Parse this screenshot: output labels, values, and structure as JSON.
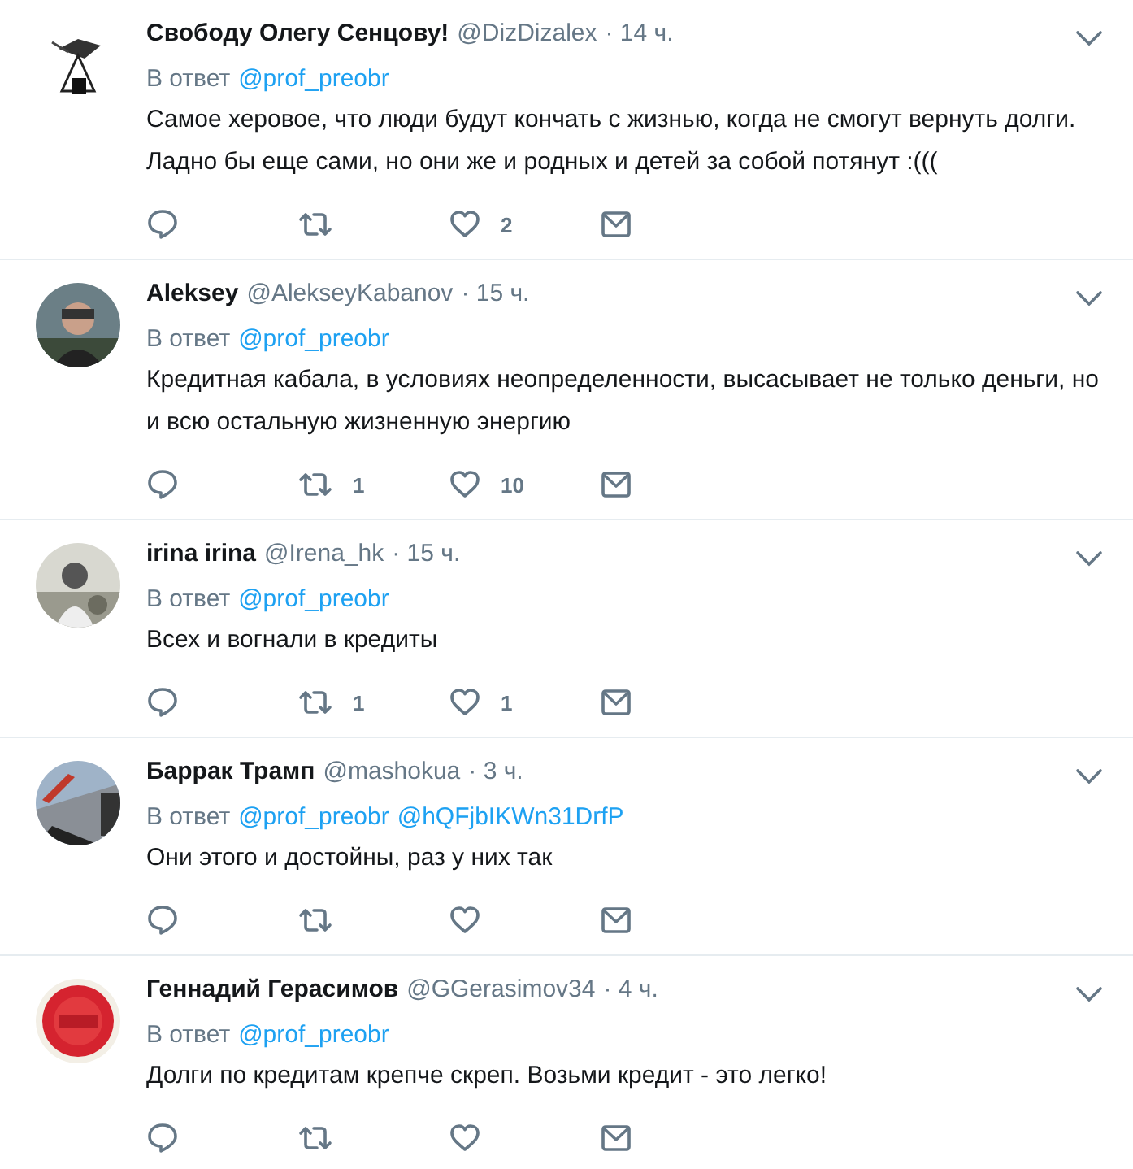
{
  "tweets": [
    {
      "name": "Свободу Олегу Сенцову!",
      "handle": "@DizDizalex",
      "time": "· 14 ч.",
      "reply_label": "В ответ",
      "mentions": [
        "@prof_preobr"
      ],
      "text": "Самое херовое, что люди будут кончать с жизнью, когда не смогут вернуть долги. Ладно бы еще сами, но они же и родных и детей за собой потянут :(((",
      "likes": "2"
    },
    {
      "name": "Aleksey",
      "handle": "@AlekseyKabanov",
      "time": "· 15 ч.",
      "reply_label": "В ответ",
      "mentions": [
        "@prof_preobr"
      ],
      "text": "Кредитная кабала, в условиях неопределенности, высасывает не только деньги, но и всю остальную жизненную энергию",
      "retweets": "1",
      "likes": "10"
    },
    {
      "name": "irina irina",
      "handle": "@Irena_hk",
      "time": "· 15 ч.",
      "reply_label": "В ответ",
      "mentions": [
        "@prof_preobr"
      ],
      "text": "Всех и вогнали в кредиты",
      "retweets": "1",
      "likes": "1"
    },
    {
      "name": "Баррак Трамп",
      "handle": "@mashokua",
      "time": "· 3 ч.",
      "reply_label": "В ответ",
      "mentions": [
        "@prof_preobr",
        "@hQFjbIKWn31DrfP"
      ],
      "text": "Они этого и достойны, раз у них так"
    },
    {
      "name": "Геннадий Герасимов",
      "handle": "@GGerasimov34",
      "time": "· 4 ч.",
      "reply_label": "В ответ",
      "mentions": [
        "@prof_preobr"
      ],
      "text": "Долги по кредитам крепче скреп. Возьми кредит - это легко!"
    }
  ]
}
